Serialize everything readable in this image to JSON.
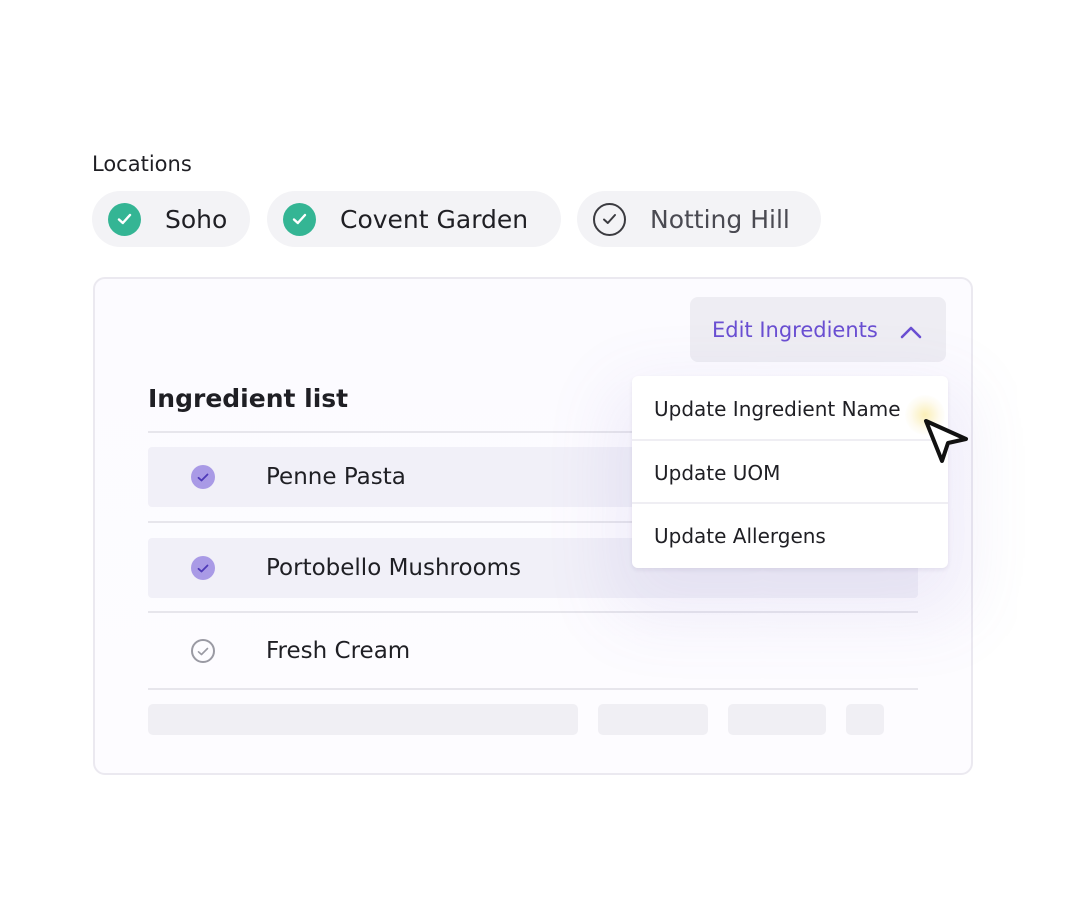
{
  "locations": {
    "label": "Locations",
    "chips": [
      {
        "name": "Soho",
        "checked": true
      },
      {
        "name": "Covent Garden",
        "checked": true
      },
      {
        "name": "Notting Hill",
        "checked": false
      }
    ]
  },
  "toolbar": {
    "edit_label": "Edit Ingredients",
    "edit_icon": "chevron-up-icon"
  },
  "dropdown": {
    "items": [
      {
        "label": "Update Ingredient Name"
      },
      {
        "label": "Update UOM"
      },
      {
        "label": "Update Allergens"
      }
    ]
  },
  "ingredients": {
    "title": "Ingredient list",
    "rows": [
      {
        "name": "Penne Pasta",
        "selected": true
      },
      {
        "name": "Portobello Mushrooms",
        "selected": true
      },
      {
        "name": "Fresh Cream",
        "selected": false
      }
    ]
  },
  "colors": {
    "accent": "#6a4fd2",
    "location_check": "#34b594",
    "row_check": "#a99ae6"
  }
}
